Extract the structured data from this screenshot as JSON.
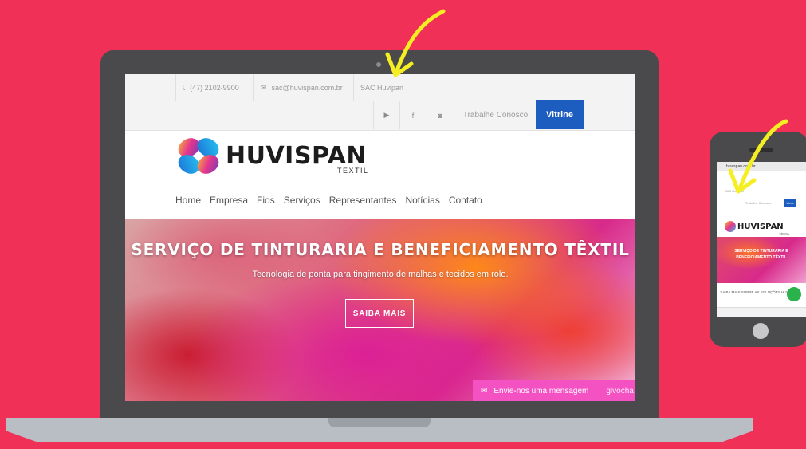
{
  "topbar": {
    "phone": "(47) 2102-9900",
    "email": "sac@huvispan.com.br",
    "sac": "SAC Huvipan",
    "trabalhe": "Trabalhe Conosco",
    "vitrine": "Vitrine"
  },
  "logo": {
    "name": "HUVISPAN",
    "sub": "TÊXTIL"
  },
  "nav": [
    "Home",
    "Empresa",
    "Fios",
    "Serviços",
    "Representantes",
    "Notícias",
    "Contato"
  ],
  "hero": {
    "title": "SERVIÇO DE TINTURARIA E BENEFICIAMENTO TÊXTIL",
    "subtitle": "Tecnologia de ponta para tingimento de malhas e tecidos em rolo.",
    "button": "SAIBA MAIS"
  },
  "chat": {
    "label": "Envie-nos uma mensagem",
    "trailing": "givocha"
  },
  "phone": {
    "url": "huvispan.com.br",
    "logo": "HUVISPAN",
    "logo_sub": "TÊXTIL",
    "vitrine": "Vitrine",
    "trabalhe": "Trabalhe Conosco",
    "sac": "SAC Huvipan",
    "hero_title": "SERVIÇO DE TINTURARIA E BENEFICIAMENTO TÊXTIL",
    "saiba": "SAIBA MAIS SOBRE AS SOLUÇÕES HUVISPAN"
  },
  "colors": {
    "background": "#f03056",
    "accent": "#1d5dbf",
    "arrow": "#f4ee22",
    "chat": "#f451c3"
  }
}
